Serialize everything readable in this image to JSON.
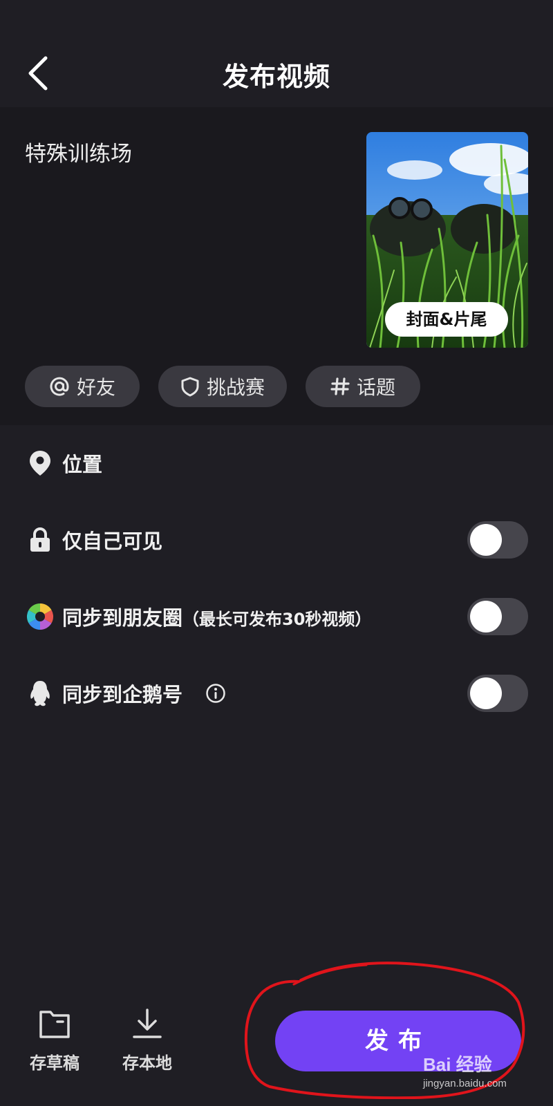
{
  "header": {
    "title": "发布视频"
  },
  "compose": {
    "description": "特殊训练场",
    "cover_button_label": "封面&片尾"
  },
  "chips": [
    {
      "label": "好友",
      "icon": "at-icon"
    },
    {
      "label": "挑战赛",
      "icon": "shield-icon"
    },
    {
      "label": "话题",
      "icon": "hashtag-icon"
    }
  ],
  "settings": {
    "location_label": "位置",
    "private_label": "仅自己可见",
    "private_on": false,
    "moments_label": "同步到朋友圈",
    "moments_note": "（最长可发布30秒视频）",
    "moments_on": false,
    "qq_label": "同步到企鹅号",
    "qq_on": false
  },
  "bottom": {
    "draft_label": "存草稿",
    "save_local_label": "存本地",
    "publish_label": "发布"
  },
  "watermark": {
    "main": "Bai 经验",
    "sub": "jingyan.baidu.com"
  },
  "colors": {
    "background": "#1f1e24",
    "compose_background": "#1a191e",
    "chip_background": "#3a3940",
    "publish_button": "#7342f4",
    "toggle_off": "#46454c",
    "annotation_circle": "#e0141b"
  }
}
